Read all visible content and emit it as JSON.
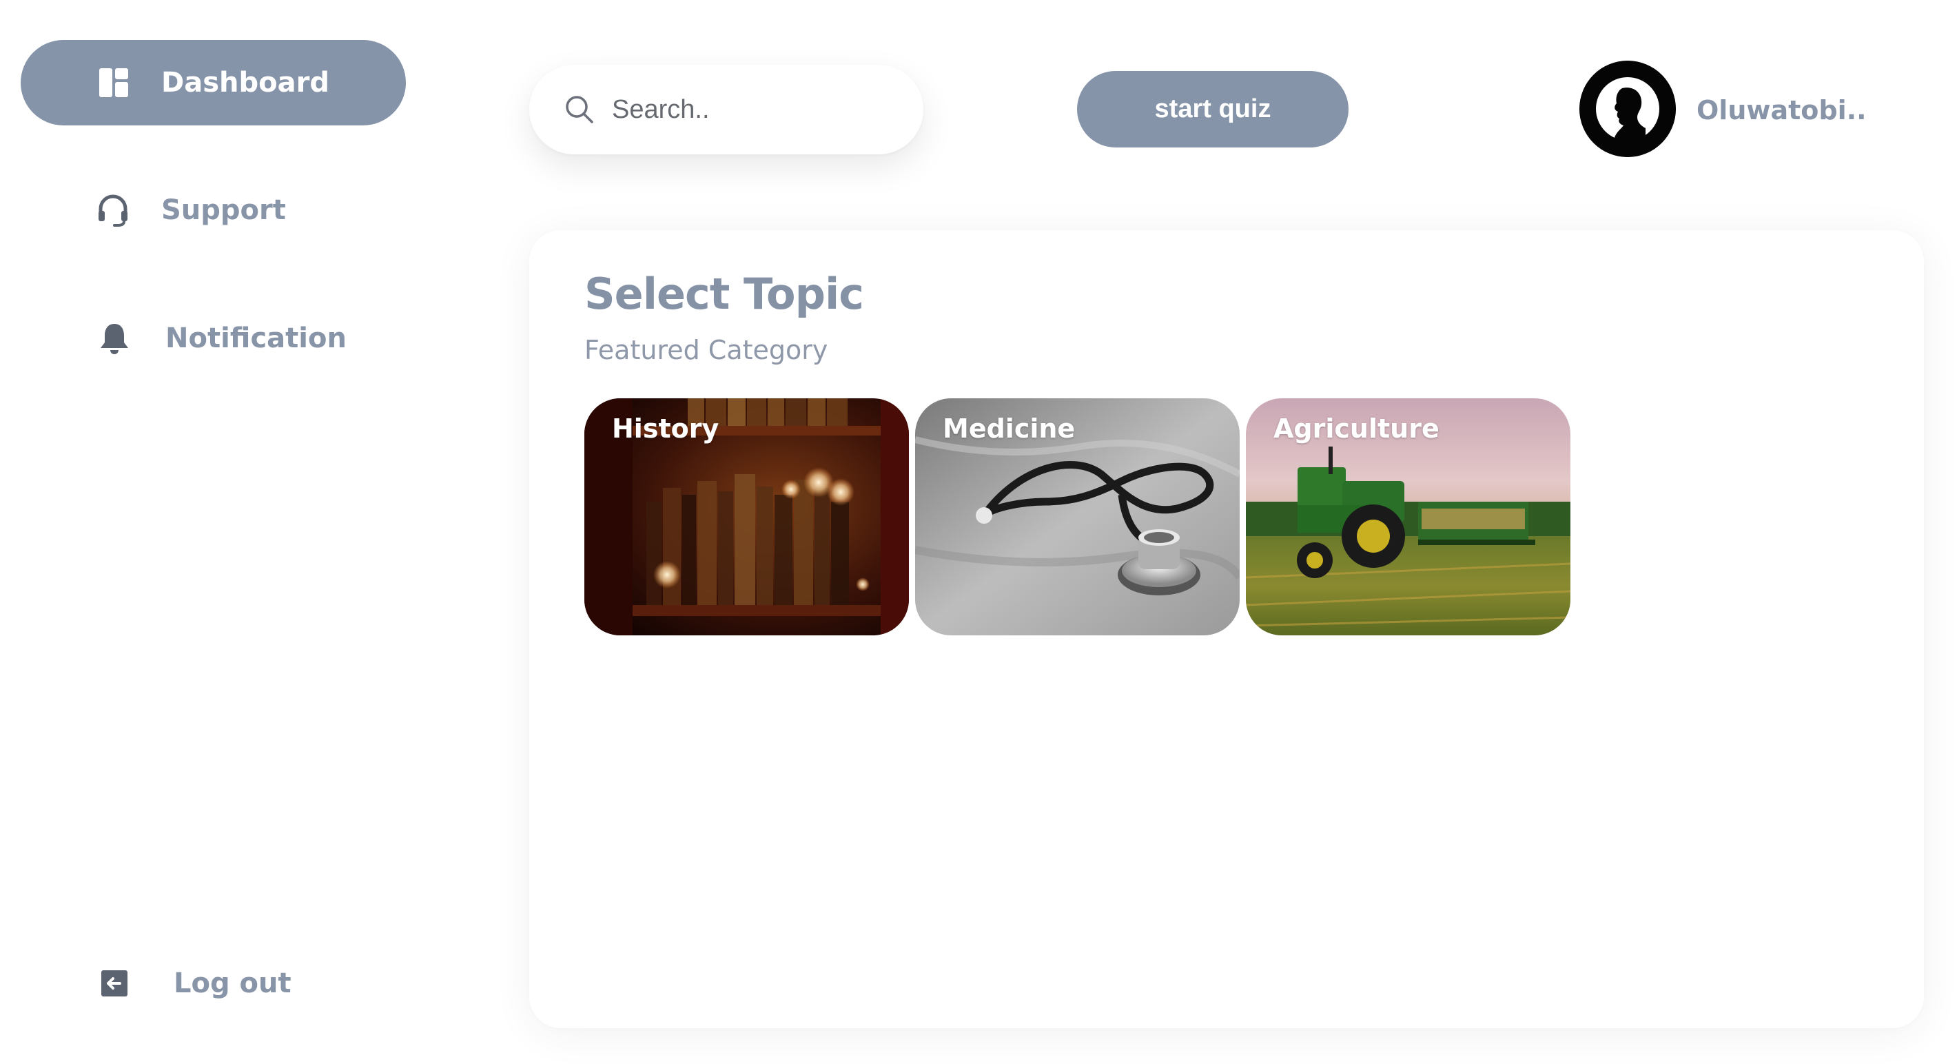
{
  "sidebar": {
    "items": [
      {
        "label": "Dashboard",
        "icon": "dashboard-icon",
        "active": true
      },
      {
        "label": "Support",
        "icon": "headset-icon",
        "active": false
      },
      {
        "label": "Notification",
        "icon": "bell-icon",
        "active": false
      }
    ],
    "logout": {
      "label": "Log out",
      "icon": "logout-icon"
    }
  },
  "header": {
    "search": {
      "placeholder": "Search..",
      "value": "",
      "icon": "search-icon"
    },
    "start_quiz_label": "start quiz",
    "user": {
      "name": "Oluwatobi..",
      "avatar": "user-silhouette-avatar"
    }
  },
  "main": {
    "title": "Select Topic",
    "subtitle": "Featured Category",
    "topics": [
      {
        "label": "History",
        "image": "bookshelf-photo"
      },
      {
        "label": "Medicine",
        "image": "stethoscope-photo"
      },
      {
        "label": "Agriculture",
        "image": "tractor-field-photo"
      }
    ]
  },
  "colors": {
    "accent": "#8694a9",
    "text_muted": "#8894a8",
    "background": "#ffffff"
  }
}
